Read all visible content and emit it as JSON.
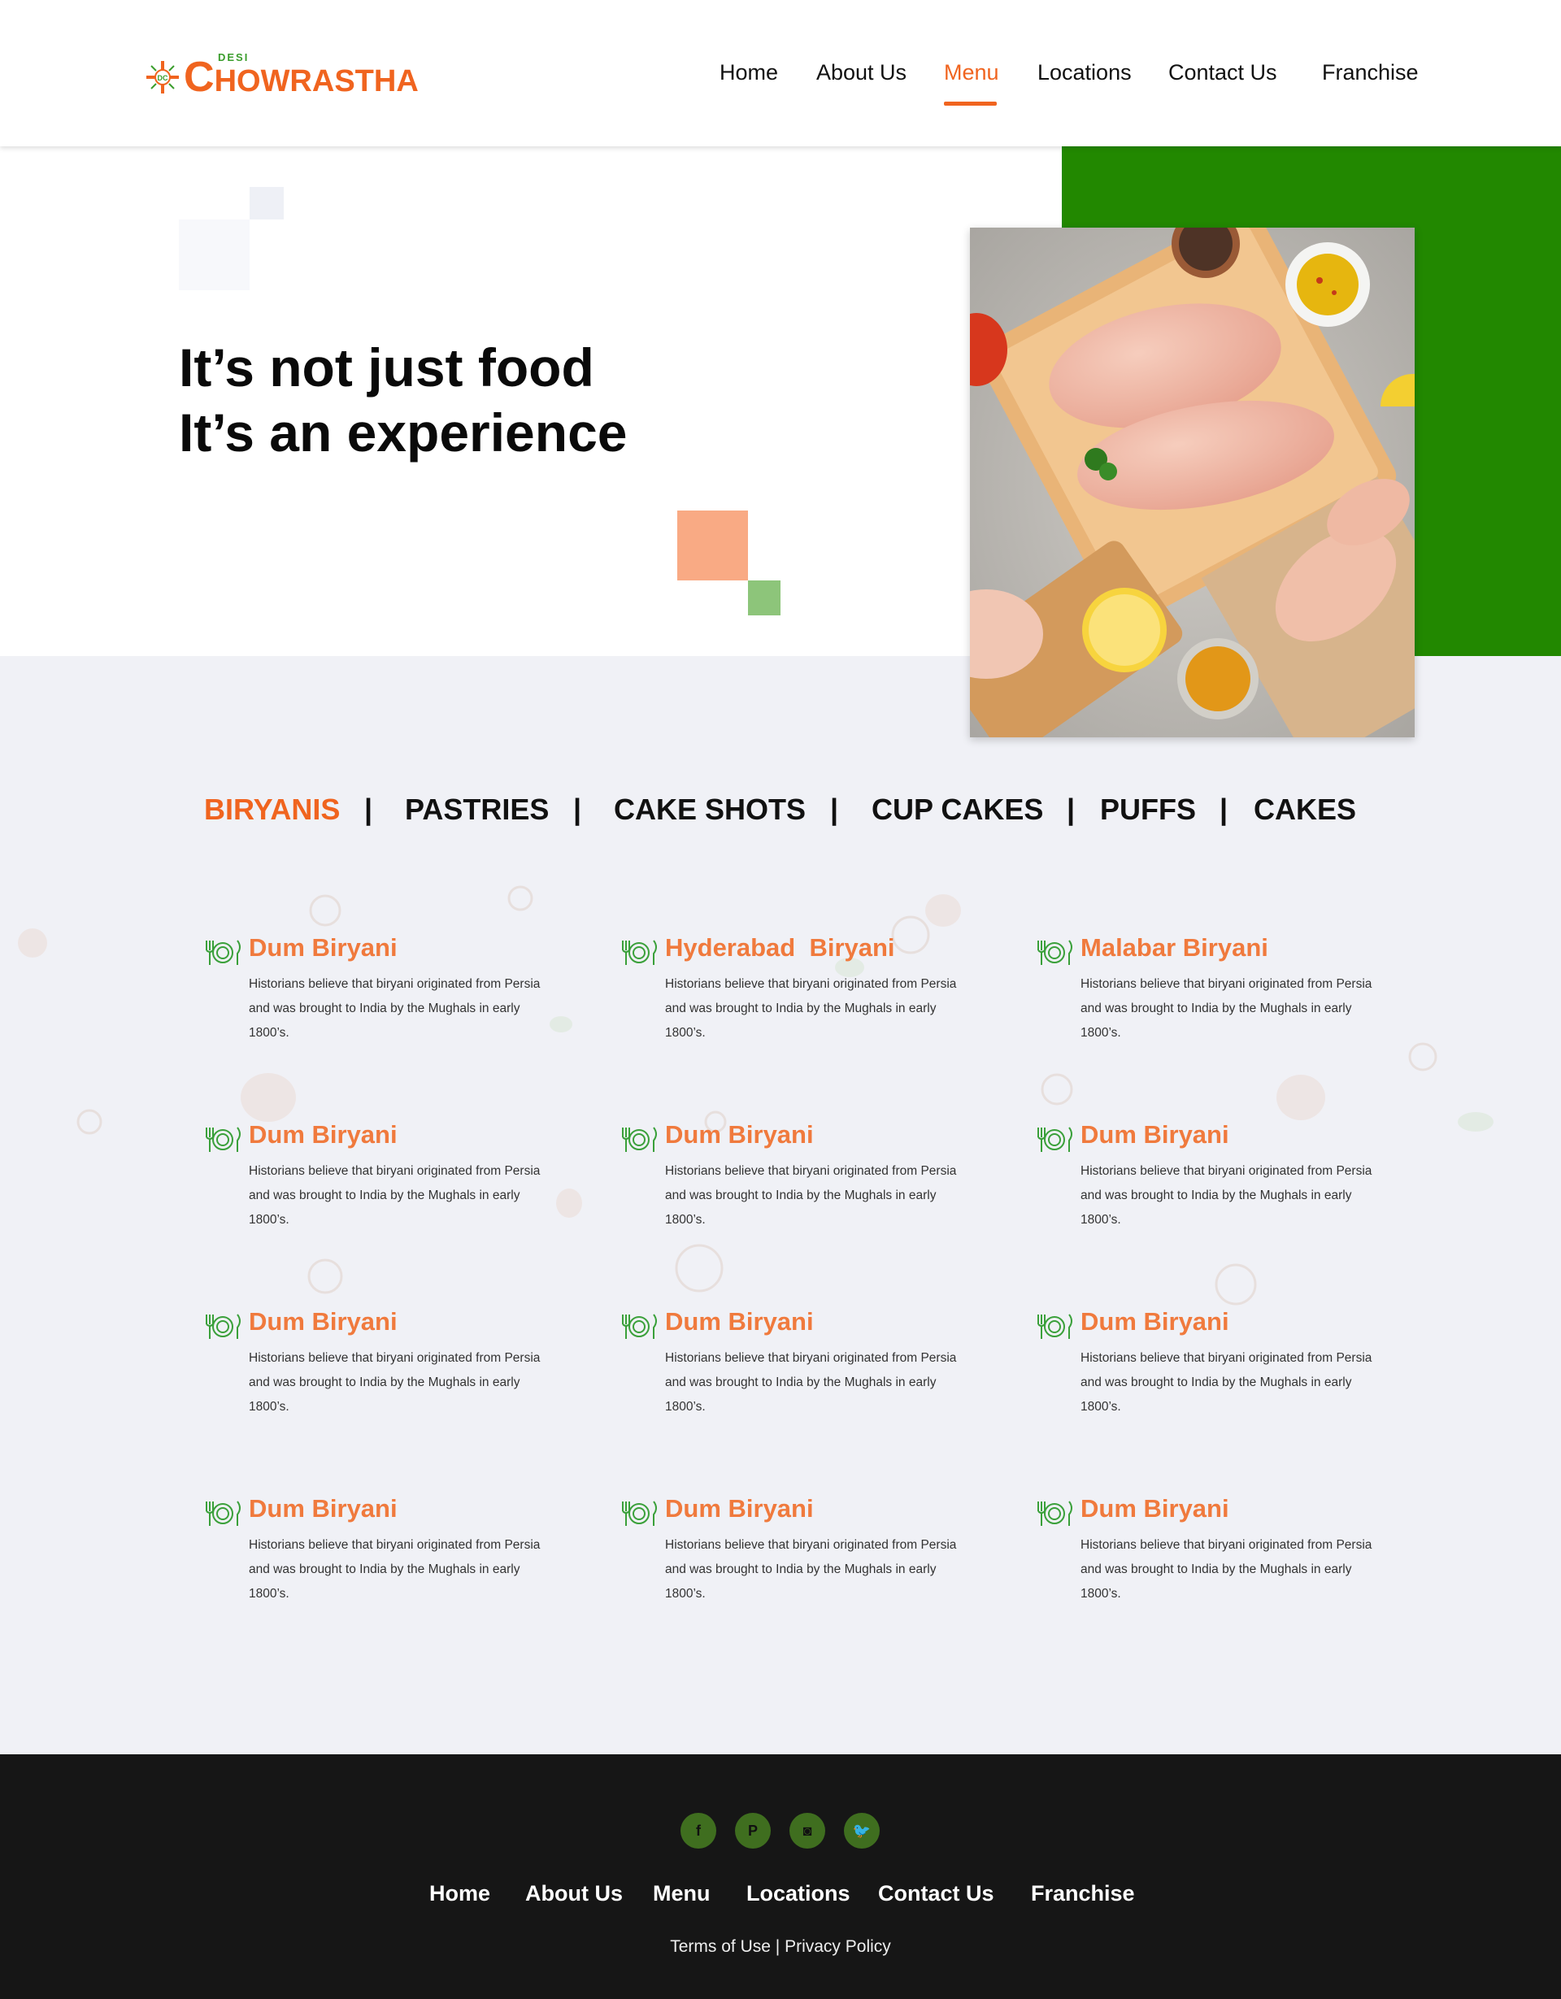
{
  "header": {
    "logo_desi": "DESI",
    "logo_first": "C",
    "logo_rest": "HOWRASTHA",
    "logo_mark": "DC",
    "nav": [
      {
        "label": "Home"
      },
      {
        "label": "About Us"
      },
      {
        "label": "Menu",
        "active": true
      },
      {
        "label": "Locations"
      },
      {
        "label": "Contact Us"
      },
      {
        "label": "Franchise"
      }
    ]
  },
  "hero": {
    "line1": "It’s not just food",
    "line2": "It’s an experience",
    "image": "raw chicken breasts on wooden cutting board with spices, lemon and tomato"
  },
  "categories": {
    "items": [
      "BIRYANIS",
      "PASTRIES",
      "CAKE SHOTS",
      "CUP CAKES",
      "PUFFS",
      "CAKES"
    ],
    "separator": "|",
    "active": "BIRYANIS"
  },
  "menu": {
    "icon": "plate-fork-knife-icon",
    "items": [
      {
        "title": "Dum Biryani",
        "desc": "Historians believe that biryani originated from Persia and was brought to India by the Mughals in early 1800’s."
      },
      {
        "title": "Hyderabad  Biryani",
        "desc": "Historians believe that biryani originated from Persia and was brought to India by the Mughals in early 1800’s."
      },
      {
        "title": "Malabar Biryani",
        "desc": "Historians believe that biryani originated from Persia and was brought to India by the Mughals in early 1800’s."
      },
      {
        "title": "Dum Biryani",
        "desc": "Historians believe that biryani originated from Persia and was brought to India by the Mughals in early 1800’s."
      },
      {
        "title": "Dum Biryani",
        "desc": "Historians believe that biryani originated from Persia and was brought to India by the Mughals in early 1800’s."
      },
      {
        "title": "Dum Biryani",
        "desc": "Historians believe that biryani originated from Persia and was brought to India by the Mughals in early 1800’s."
      },
      {
        "title": "Dum Biryani",
        "desc": "Historians believe that biryani originated from Persia and was brought to India by the Mughals in early 1800’s."
      },
      {
        "title": "Dum Biryani",
        "desc": "Historians believe that biryani originated from Persia and was brought to India by the Mughals in early 1800’s."
      },
      {
        "title": "Dum Biryani",
        "desc": "Historians believe that biryani originated from Persia and was brought to India by the Mughals in early 1800’s."
      },
      {
        "title": "Dum Biryani",
        "desc": "Historians believe that biryani originated from Persia and was brought to India by the Mughals in early 1800’s."
      },
      {
        "title": "Dum Biryani",
        "desc": "Historians believe that biryani originated from Persia and was brought to India by the Mughals in early 1800’s."
      },
      {
        "title": "Dum Biryani",
        "desc": "Historians believe that biryani originated from Persia and was brought to India by the Mughals in early 1800’s."
      }
    ]
  },
  "footer": {
    "social": [
      {
        "name": "facebook-icon",
        "glyph": "f"
      },
      {
        "name": "pinterest-icon",
        "glyph": "P"
      },
      {
        "name": "instagram-icon",
        "glyph": "◙"
      },
      {
        "name": "twitter-icon",
        "glyph": "🐦"
      }
    ],
    "nav": [
      "Home",
      "About Us",
      "Menu",
      "Locations",
      "Contact Us",
      "Franchise"
    ],
    "terms": "Terms of Use",
    "legal_sep": "|",
    "privacy": "Privacy Policy"
  },
  "colors": {
    "accent": "#f0641f",
    "green": "#228800",
    "footer_bg": "#161616",
    "page_bg": "#f0f1f6"
  }
}
